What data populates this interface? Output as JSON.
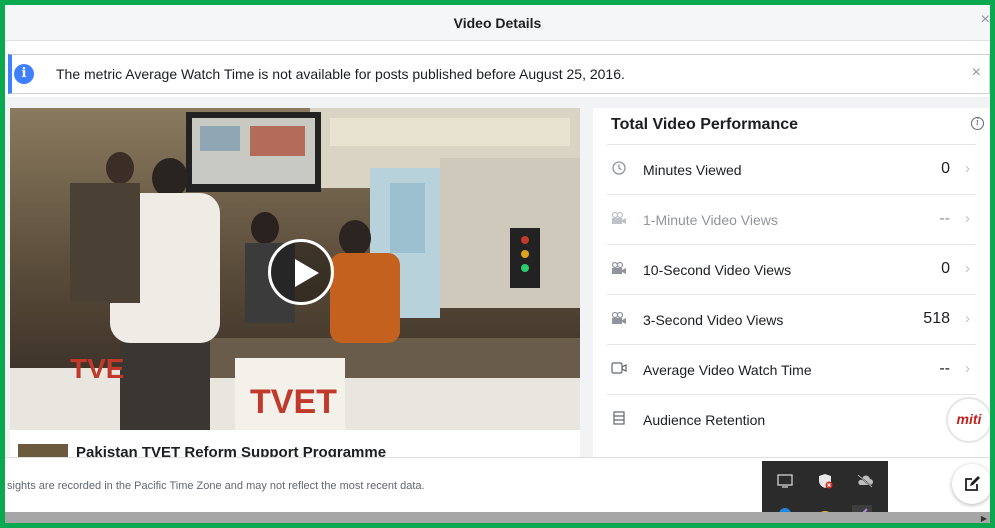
{
  "dialog": {
    "title": "Video Details",
    "close_icon": "close-icon"
  },
  "notice": {
    "text": "The metric Average Watch Time is not available for posts published before August 25, 2016.",
    "info_icon": "info-icon",
    "close_icon": "close-icon"
  },
  "video": {
    "caption": "Pakistan TVET Reform Support Programme",
    "play_icon": "play-icon"
  },
  "performance": {
    "title": "Total Video Performance",
    "rows": [
      {
        "label": "Minutes Viewed",
        "value": "0",
        "icon": "clock-icon",
        "muted": false
      },
      {
        "label": "1-Minute Video Views",
        "value": "--",
        "icon": "video-camera-icon",
        "muted": true
      },
      {
        "label": "10-Second Video Views",
        "value": "0",
        "icon": "video-camera-icon",
        "muted": false
      },
      {
        "label": "3-Second Video Views",
        "value": "518",
        "icon": "video-camera-icon",
        "muted": false
      },
      {
        "label": "Average Video Watch Time",
        "value": "--",
        "icon": "video-icon",
        "muted": false
      },
      {
        "label": "Audience Retention",
        "value": "",
        "icon": "film-icon",
        "muted": false
      }
    ]
  },
  "footer": {
    "note": "sights are recorded in the Pacific Time Zone and may not reflect the most recent data."
  },
  "overlay": {
    "logo_text": "miti"
  },
  "colors": {
    "frame_border": "#0aa84f",
    "info_accent": "#4080ff"
  }
}
